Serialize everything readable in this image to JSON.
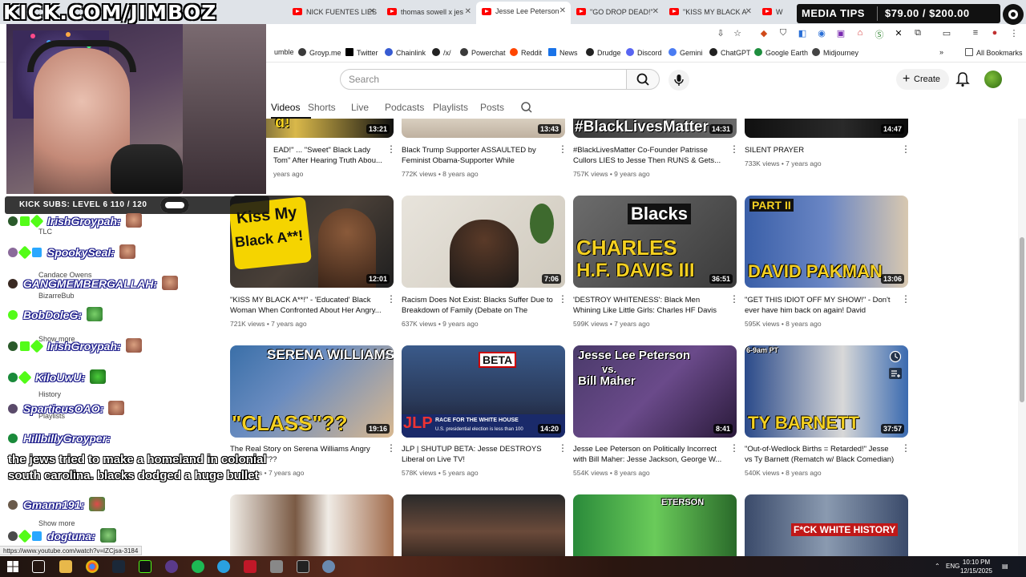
{
  "browser": {
    "tabs": [
      {
        "label": "NICK FUENTES LIES"
      },
      {
        "label": "thomas sowell x jes"
      },
      {
        "label": "Jesse Lee Peterson"
      },
      {
        "label": "\"GO DROP DEAD!\""
      },
      {
        "label": "\"KISS MY BLACK A"
      },
      {
        "label": "W"
      }
    ],
    "bookmarks": [
      {
        "label": "umble",
        "color": "#85c742"
      },
      {
        "label": "Groyp.me",
        "color": "#3a3a3a"
      },
      {
        "label": "Twitter",
        "color": "#000000"
      },
      {
        "label": "Chainlink",
        "color": "#375bd2"
      },
      {
        "label": "/x/",
        "color": "#222222"
      },
      {
        "label": "Powerchat",
        "color": "#3a3a3a"
      },
      {
        "label": "Reddit",
        "color": "#ff4500"
      },
      {
        "label": "News",
        "color": "#1a73e8"
      },
      {
        "label": "Drudge",
        "color": "#222222"
      },
      {
        "label": "Discord",
        "color": "#5865f2"
      },
      {
        "label": "Gemini",
        "color": "#4a7cf2"
      },
      {
        "label": "ChatGPT",
        "color": "#202020"
      },
      {
        "label": "Google Earth",
        "color": "#1e8e3e"
      },
      {
        "label": "Midjourney",
        "color": "#444444"
      }
    ],
    "all_bookmarks_label": "All Bookmarks",
    "status_url": "https://www.youtube.com/watch?v=lZCjsa-3184"
  },
  "youtube": {
    "search_placeholder": "Search",
    "create_label": "Create",
    "channel_tabs": [
      "Videos",
      "Shorts",
      "Live",
      "Podcasts",
      "Playlists",
      "Posts"
    ],
    "top_row": [
      {
        "title": "EAD!\" ... \"Sweet\" Black Lady Tom\" After Hearing Truth Abou...",
        "meta": "years ago",
        "duration": "13:21"
      },
      {
        "title": "Black Trump Supporter ASSAULTED by Feminist Obama-Supporter While Speaking...",
        "meta": "772K views • 8 years ago",
        "duration": "13:43"
      },
      {
        "title": "#BlackLivesMatter Co-Founder Patrisse Cullors LIES to Jesse Then RUNS & Gets...",
        "meta": "757K views • 9 years ago",
        "duration": "14:31"
      },
      {
        "title": "SILENT PRAYER",
        "meta": "733K views • 7 years ago",
        "duration": "14:47"
      }
    ],
    "row2": [
      {
        "title": "\"KISS MY BLACK A**!\" - 'Educated' Black Woman When Confronted About Her Angry...",
        "meta": "721K views • 7 years ago",
        "duration": "12:01",
        "thumb_text": "Kiss My Black A**!"
      },
      {
        "title": "Racism Does Not Exist: Blacks Suffer Due to Breakdown of Family (Debate on The Fallen...",
        "meta": "637K views • 9 years ago",
        "duration": "7:06",
        "thumb_text": ""
      },
      {
        "title": "'DESTROY WHITENESS': Black Men Whining Like Little Girls: Charles HF Davis III, PhD, a...",
        "meta": "599K views • 7 years ago",
        "duration": "36:51",
        "thumb_text": "Blacks",
        "thumb_text2": "CHARLES H.F. DAVIS III"
      },
      {
        "title": "\"GET THIS IDIOT OFF MY SHOW!\" - Don't ever have him back on again! David Pakman...",
        "meta": "595K views • 8 years ago",
        "duration": "13:06",
        "thumb_text": "PART II",
        "thumb_text2": "DAVID PAKMAN"
      }
    ],
    "row3": [
      {
        "title": "The Real Story on Serena Williams Angry sts: \"Class\"??",
        "meta": "views • 7 years ago",
        "duration": "19:16",
        "thumb_text": "SERENA WILLIAMS",
        "thumb_text2": "\"CLASS\"??"
      },
      {
        "title": "JLP | SHUTUP BETA: Jesse DESTROYS Liberal on Live TV!",
        "meta": "578K views • 5 years ago",
        "duration": "14:20",
        "thumb_text": "BETA",
        "thumb_text2": "JLP",
        "thumb_text3": "RACE FOR THE WHITE HOUSE",
        "thumb_text4": "U.S. presidential election is less than 100"
      },
      {
        "title": "Jesse Lee Peterson on Politically Incorrect with Bill Maher: Jesse Jackson, George W...",
        "meta": "554K views • 8 years ago",
        "duration": "8:41",
        "thumb_text": "Jesse Lee Peterson",
        "thumb_text2": "vs.",
        "thumb_text3": "Bill Maher"
      },
      {
        "title": "\"Out-of-Wedlock Births = Retarded!\" Jesse vs Ty Barnett (Rematch w/ Black Comedian)",
        "meta": "540K views • 8 years ago",
        "duration": "37:57",
        "thumb_text": "TY BARNETT",
        "thumb_text2": "6-9am PT"
      }
    ],
    "row4": [
      {
        "thumb_text": ""
      },
      {
        "thumb_text": ""
      },
      {
        "thumb_text": "ETERSON"
      },
      {
        "thumb_text": "F*CK WHITE HISTORY"
      }
    ]
  },
  "overlay": {
    "logo_text": "KICK.COM/JIMBOZ",
    "subs_bar": "KICK SUBS: LEVEL 6 110 / 120",
    "media_tips_label": "MEDIA TIPS",
    "media_tips_amount": "$79.00 / $200.00",
    "chat": [
      {
        "user": "IrishGroypah:"
      },
      {
        "user": "SpookySeal:"
      },
      {
        "user": "GANGMEMBERGALLAH:"
      },
      {
        "user": "BobDoleG:"
      },
      {
        "user": "IrishGroypah:"
      },
      {
        "user": "KiloUwU:"
      },
      {
        "user": "SparticusOAO:"
      },
      {
        "user": "HillbillyGroyper:"
      },
      {
        "user": "Gmann191:"
      },
      {
        "user": "dogtuna:"
      }
    ],
    "caption": "the jews tried to make a homeland in colonial south carolina. blacks dodged a huge bullet",
    "underlying_sidebar": [
      "TLC",
      "Candace Owens",
      "BizarreBub",
      "Show more",
      "History",
      "Playlists",
      "Show more"
    ]
  },
  "taskbar": {
    "lang": "ENG",
    "time": "10:10 PM",
    "date": "12/15/2025"
  }
}
